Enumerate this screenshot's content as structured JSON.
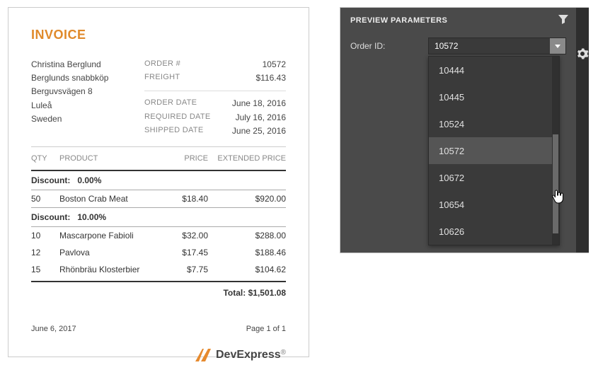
{
  "invoice": {
    "heading": "INVOICE",
    "customer": {
      "name": "Christina Berglund",
      "company": "Berglunds snabbköp",
      "street": "Berguvsvägen  8",
      "city": "Luleå",
      "country": "Sweden"
    },
    "order_meta": {
      "order_num_label": "ORDER #",
      "order_num": "10572",
      "freight_label": "FREIGHT",
      "freight": "$116.43",
      "order_date_label": "ORDER DATE",
      "order_date": "June 18, 2016",
      "required_date_label": "REQUIRED DATE",
      "required_date": "July 16, 2016",
      "shipped_date_label": "SHIPPED DATE",
      "shipped_date": "June 25, 2016"
    },
    "columns": {
      "qty": "QTY",
      "product": "PRODUCT",
      "price": "PRICE",
      "extended": "EXTENDED PRICE"
    },
    "groups": [
      {
        "discount_label": "Discount:",
        "discount_value": "0.00%",
        "lines": [
          {
            "qty": "50",
            "product": "Boston Crab Meat",
            "price": "$18.40",
            "ext": "$920.00"
          }
        ]
      },
      {
        "discount_label": "Discount:",
        "discount_value": "10.00%",
        "lines": [
          {
            "qty": "10",
            "product": "Mascarpone Fabioli",
            "price": "$32.00",
            "ext": "$288.00"
          },
          {
            "qty": "12",
            "product": "Pavlova",
            "price": "$17.45",
            "ext": "$188.46"
          },
          {
            "qty": "15",
            "product": "Rhönbräu Klosterbier",
            "price": "$7.75",
            "ext": "$104.62"
          }
        ]
      }
    ],
    "total_label": "Total:",
    "total_value": "$1,501.08",
    "footer_date": "June 6, 2017",
    "footer_page": "Page 1 of 1",
    "brand_bold": "Dev",
    "brand_rest": "Express"
  },
  "params": {
    "title": "PREVIEW PARAMETERS",
    "field_label": "Order ID:",
    "input_value": "10572",
    "options": [
      "10444",
      "10445",
      "10524",
      "10572",
      "10672",
      "10654",
      "10626"
    ],
    "selected_index": 3
  }
}
